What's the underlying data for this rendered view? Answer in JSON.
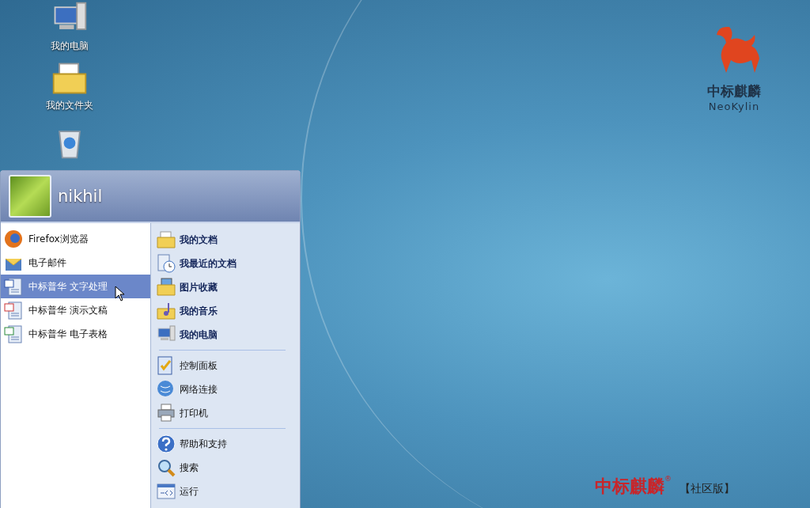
{
  "desktop_icons": [
    {
      "kind": "computer",
      "label": "我的电脑"
    },
    {
      "kind": "folder",
      "label": "我的文件夹"
    },
    {
      "kind": "trash"
    }
  ],
  "start_menu": {
    "user_name": "nikhil",
    "programs": [
      {
        "kind": "browser",
        "label": "Firefox浏览器",
        "selected": false
      },
      {
        "kind": "mail",
        "label": "电子邮件",
        "selected": false
      },
      {
        "kind": "writer",
        "label": "中标普华  文字处理",
        "selected": true
      },
      {
        "kind": "presentation",
        "label": "中标普华  演示文稿",
        "selected": false
      },
      {
        "kind": "spreadsheet",
        "label": "中标普华  电子表格",
        "selected": false
      }
    ],
    "sections": [
      {
        "emphasized": true,
        "items": [
          {
            "kind": "documents",
            "label": "我的文档"
          },
          {
            "kind": "recent",
            "label": "我最近的文档"
          },
          {
            "kind": "pictures",
            "label": "图片收藏"
          },
          {
            "kind": "music",
            "label": "我的音乐"
          },
          {
            "kind": "computer",
            "label": "我的电脑"
          }
        ]
      },
      {
        "emphasized": false,
        "items": [
          {
            "kind": "control",
            "label": "控制面板"
          },
          {
            "kind": "network",
            "label": "网络连接"
          },
          {
            "kind": "printer",
            "label": "打印机"
          }
        ]
      },
      {
        "emphasized": false,
        "items": [
          {
            "kind": "help",
            "label": "帮助和支持"
          },
          {
            "kind": "search",
            "label": "搜索"
          },
          {
            "kind": "run",
            "label": "运行"
          }
        ]
      }
    ]
  },
  "logo": {
    "name": "中标麒麟",
    "subtitle": "NeoKylin"
  },
  "brand": {
    "name": "中标麒麟",
    "mark": "®",
    "edition": "【社区版】"
  }
}
